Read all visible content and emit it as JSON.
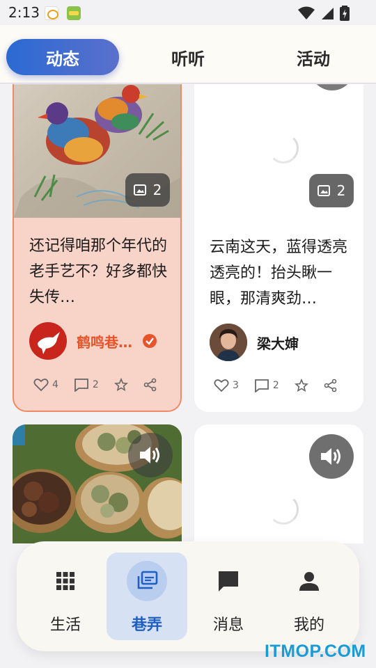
{
  "status_bar": {
    "time": "2:13",
    "icons": [
      "app-icon-yc",
      "app-icon-green",
      "wifi-icon",
      "signal-icon",
      "battery-icon"
    ]
  },
  "tabs": [
    {
      "label": "动态",
      "active": true
    },
    {
      "label": "听听",
      "active": false
    },
    {
      "label": "活动",
      "active": false
    }
  ],
  "cards": [
    {
      "type": "image",
      "image_count": "2",
      "title": "还记得咱那个年代的老手艺不？好多都快失传…",
      "author": "鹤鸣巷…",
      "verified": true,
      "likes": "4",
      "comments": "2",
      "highlighted": true
    },
    {
      "type": "image",
      "image_count": "2",
      "title": "云南这天，蓝得透亮透亮的！抬头瞅一眼，那清爽劲…",
      "author": "梁大婶",
      "verified": false,
      "likes": "3",
      "comments": "2",
      "highlighted": false
    },
    {
      "type": "audio",
      "icon": "speaker-icon"
    },
    {
      "type": "audio",
      "icon": "speaker-icon"
    }
  ],
  "bottom_nav": [
    {
      "label": "生活",
      "icon": "grid-icon",
      "active": false
    },
    {
      "label": "巷弄",
      "icon": "gallery-icon",
      "active": true
    },
    {
      "label": "消息",
      "icon": "chat-icon",
      "active": false
    },
    {
      "label": "我的",
      "icon": "person-icon",
      "active": false
    }
  ],
  "watermark": "ITMOP.COM",
  "colors": {
    "accent": "#2b6ad3",
    "author_highlight": "#e5542a",
    "card_highlight_bg": "#f8d3c8",
    "nav_active_bg": "#d6e2f4"
  }
}
